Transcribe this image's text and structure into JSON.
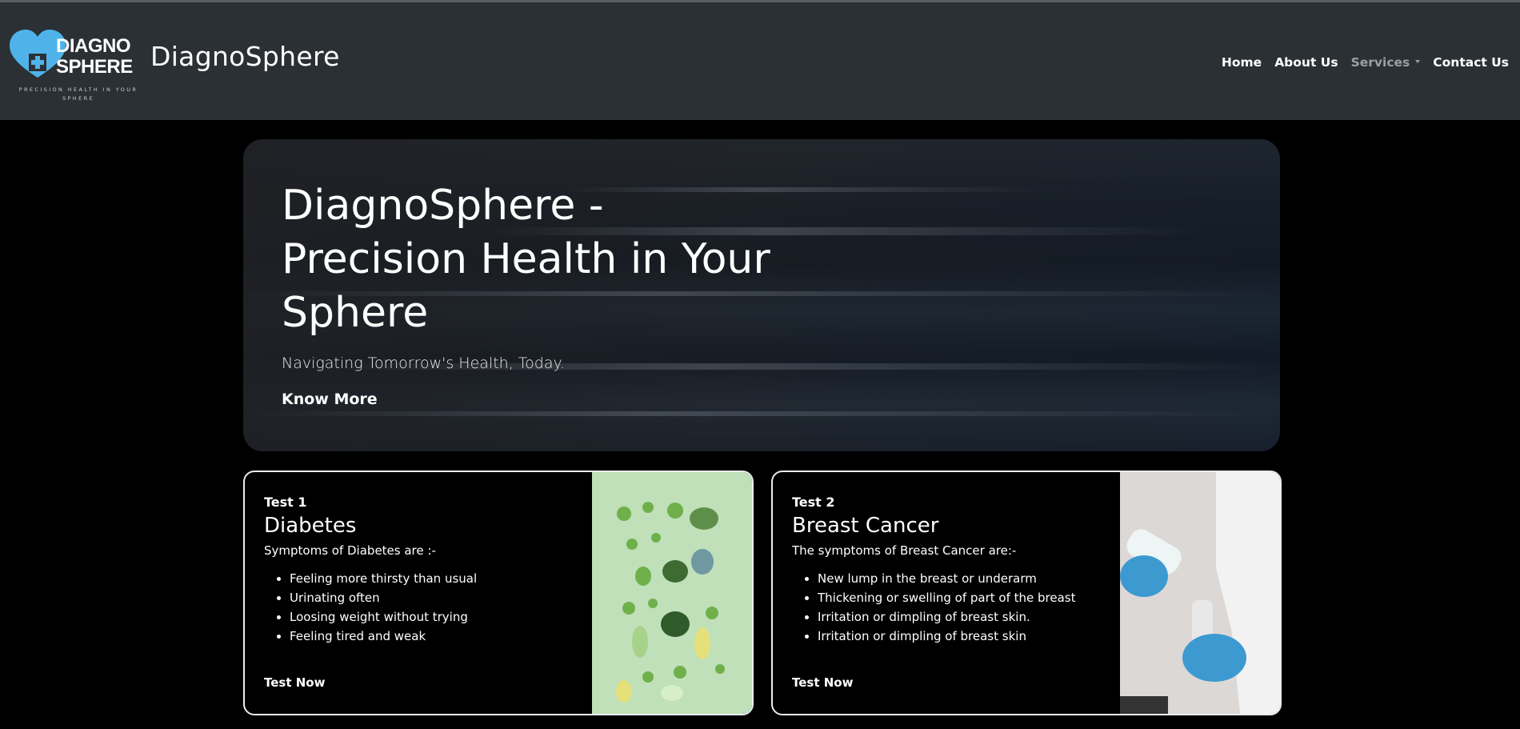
{
  "header": {
    "logo_line1": "DIAGNO",
    "logo_line2": "SPHERE",
    "logo_tagline": "PRECISION HEALTH IN YOUR SPHERE",
    "brand": "DiagnoSphere",
    "nav": {
      "home": "Home",
      "about": "About Us",
      "services": "Services",
      "contact": "Contact Us"
    },
    "colors": {
      "bar": "#2b3035",
      "logo_accent": "#4fb3ea"
    }
  },
  "hero": {
    "title": "DiagnoSphere - Precision Health in Your Sphere",
    "subtitle": "Navigating Tomorrow's Health, Today.",
    "button": "Know More"
  },
  "cards": [
    {
      "subtitle": "Test 1",
      "title": "Diabetes",
      "lead": "Symptoms of Diabetes are :-",
      "items": [
        "Feeling more thirsty than usual",
        "Urinating often",
        "Loosing weight without trying",
        "Feeling tired and weak"
      ],
      "link": "Test Now",
      "image_icon": "vegetables-image"
    },
    {
      "subtitle": "Test 2",
      "title": "Breast Cancer",
      "lead": "The symptoms of Breast Cancer are:-",
      "items": [
        "New lump in the breast or underarm",
        "Thickening or swelling of part of the breast",
        "Irritation or dimpling of breast skin.",
        "Irritation or dimpling of breast skin"
      ],
      "link": "Test Now",
      "image_icon": "ultrasound-image"
    }
  ]
}
